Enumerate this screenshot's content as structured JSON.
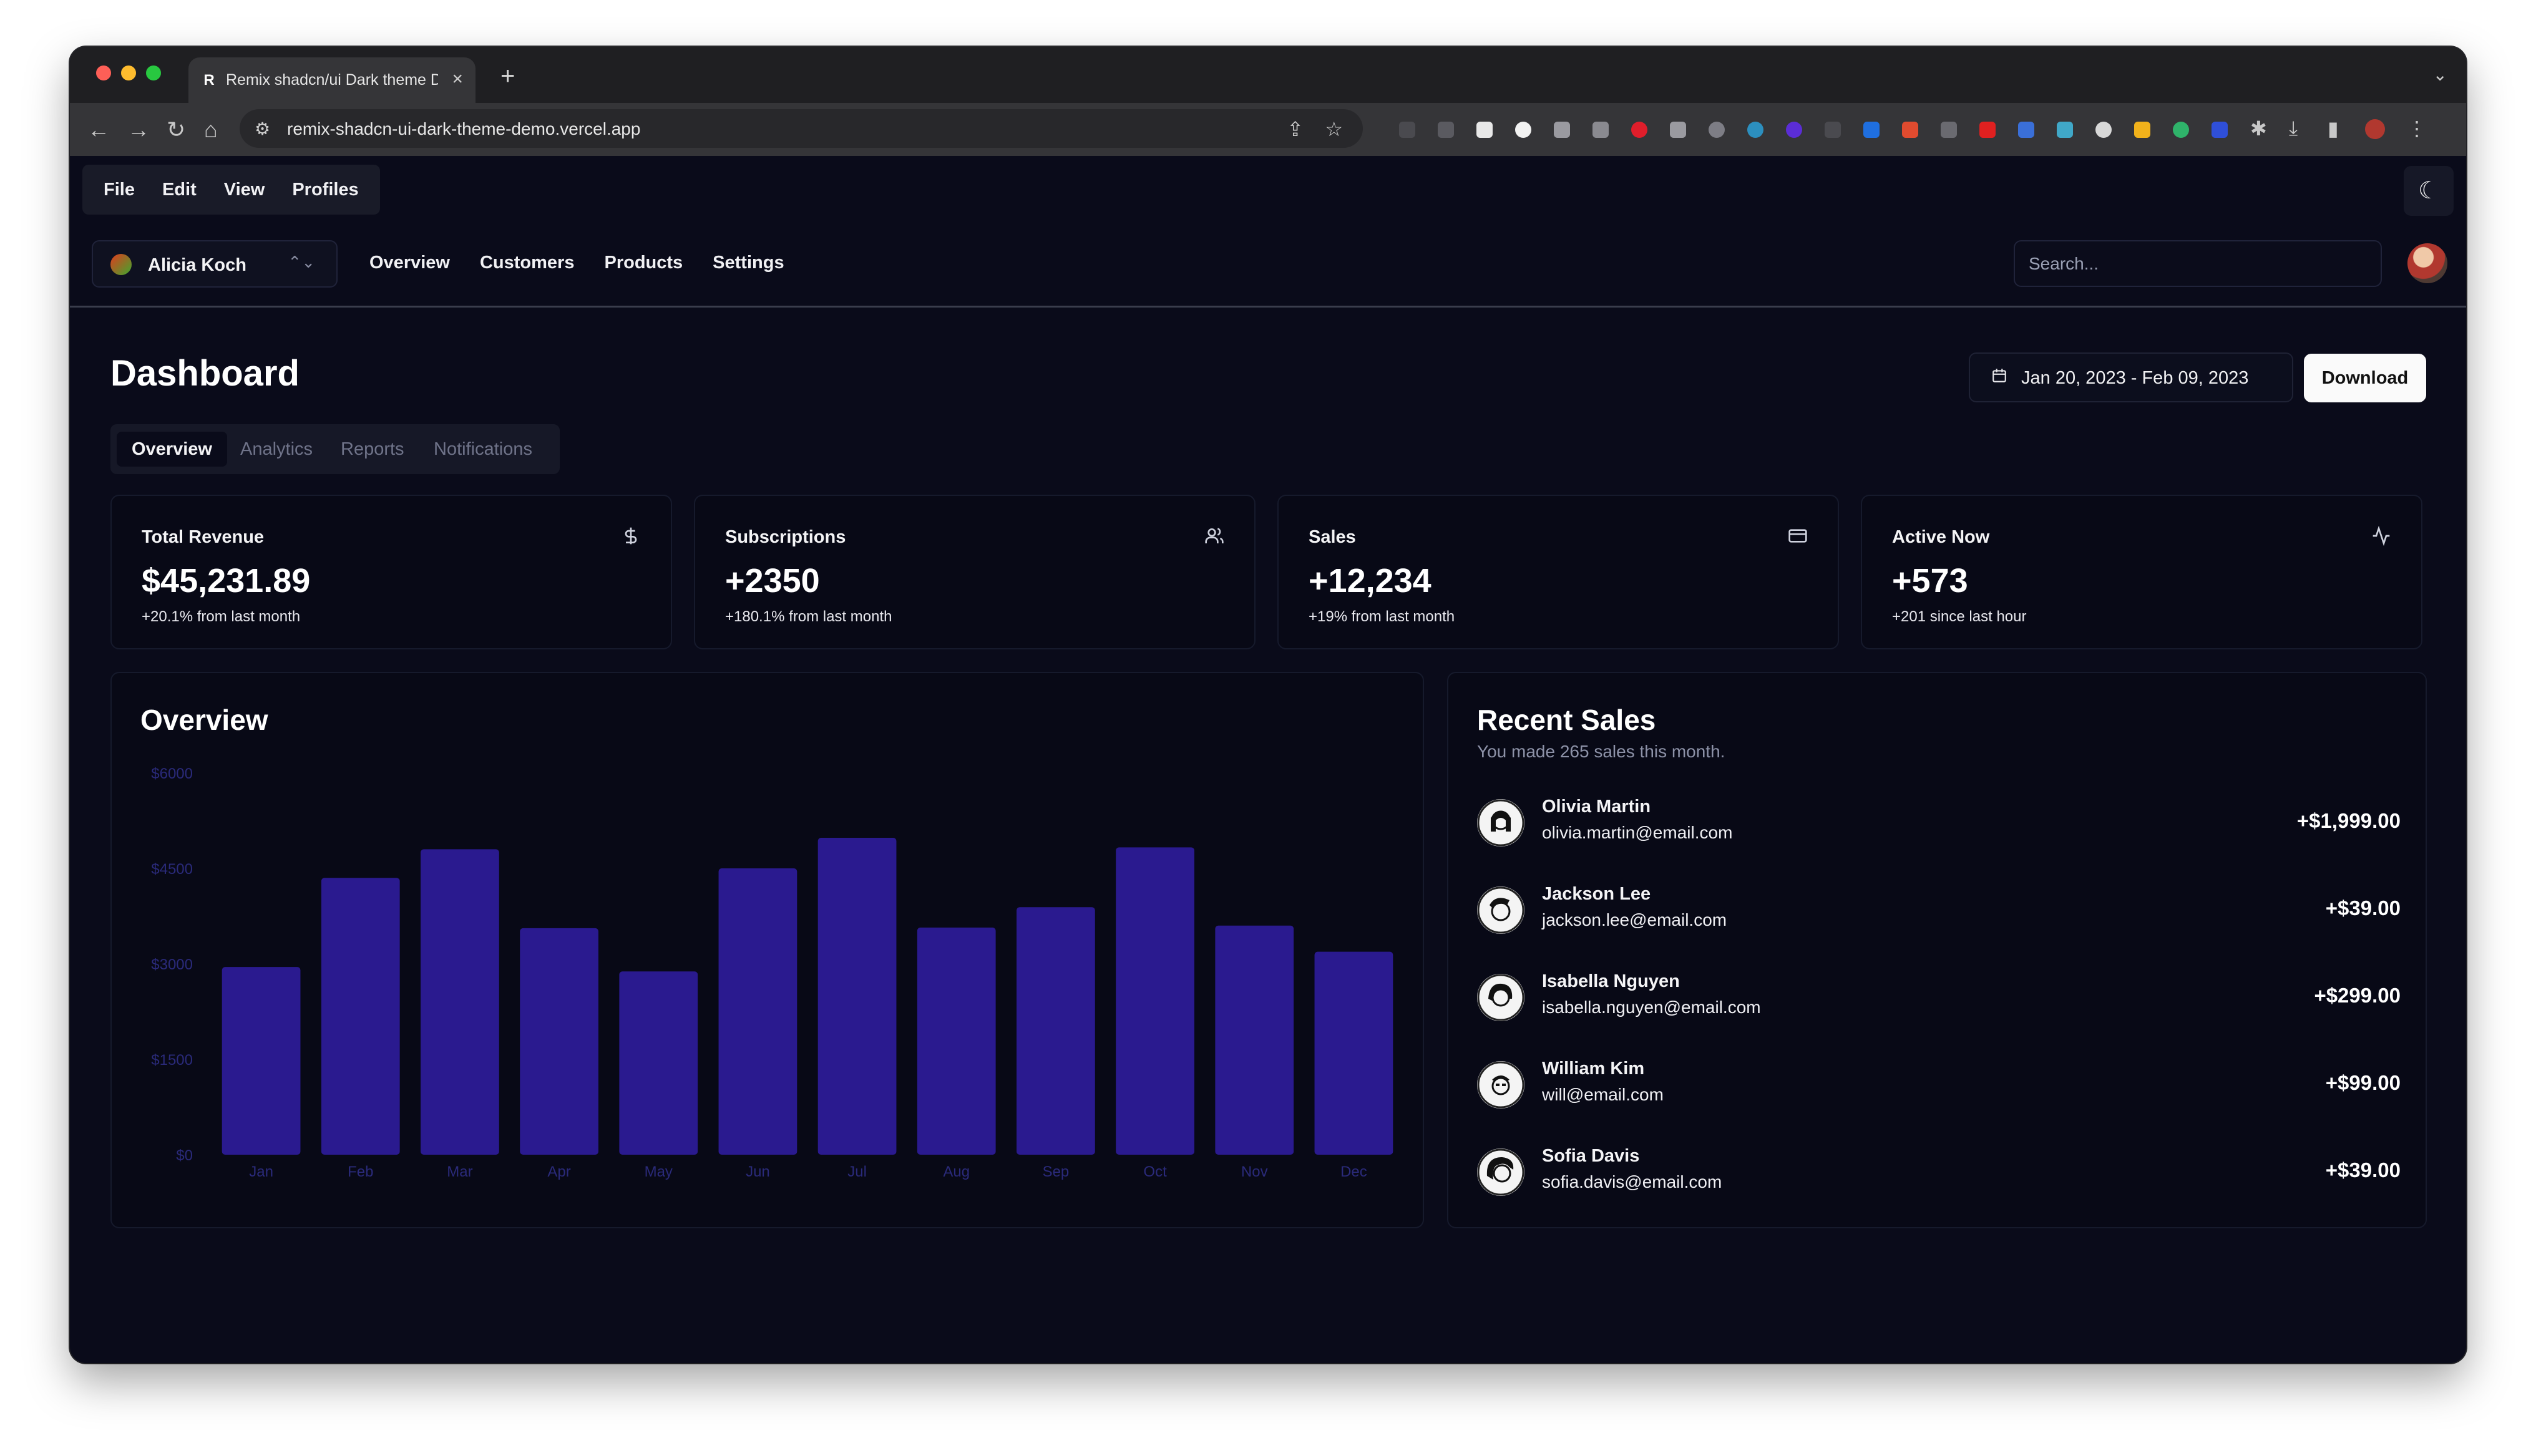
{
  "browser": {
    "tab_title": "Remix shadcn/ui Dark theme D",
    "tab_favicon": "R",
    "url": "remix-shadcn-ui-dark-theme-demo.vercel.app"
  },
  "menubar": {
    "items": [
      "File",
      "Edit",
      "View",
      "Profiles"
    ]
  },
  "team_switcher": {
    "name": "Alicia Koch"
  },
  "nav": {
    "links": [
      "Overview",
      "Customers",
      "Products",
      "Settings"
    ]
  },
  "search": {
    "placeholder": "Search..."
  },
  "page": {
    "title": "Dashboard",
    "date_range": "Jan 20, 2023 - Feb 09, 2023",
    "download_label": "Download",
    "tabs": [
      "Overview",
      "Analytics",
      "Reports",
      "Notifications"
    ],
    "active_tab": "Overview"
  },
  "stats": [
    {
      "title": "Total Revenue",
      "value": "$45,231.89",
      "sub": "+20.1% from last month",
      "icon": "dollar-icon"
    },
    {
      "title": "Subscriptions",
      "value": "+2350",
      "sub": "+180.1% from last month",
      "icon": "users-icon"
    },
    {
      "title": "Sales",
      "value": "+12,234",
      "sub": "+19% from last month",
      "icon": "credit-card-icon"
    },
    {
      "title": "Active Now",
      "value": "+573",
      "sub": "+201 since last hour",
      "icon": "activity-icon"
    }
  ],
  "overview": {
    "title": "Overview"
  },
  "chart_data": {
    "type": "bar",
    "categories": [
      "Jan",
      "Feb",
      "Mar",
      "Apr",
      "May",
      "Jun",
      "Jul",
      "Aug",
      "Sep",
      "Oct",
      "Nov",
      "Dec"
    ],
    "values": [
      2950,
      4350,
      4800,
      3560,
      2880,
      4500,
      4980,
      3570,
      3890,
      4830,
      3600,
      3190
    ],
    "ylim": [
      0,
      6000
    ],
    "yticks": [
      "$0",
      "$1500",
      "$3000",
      "$4500",
      "$6000"
    ],
    "ytick_values": [
      0,
      1500,
      3000,
      4500,
      6000
    ],
    "bar_color": "#2a1a8f",
    "axis_color": "#2a2a7a",
    "grid": false
  },
  "recent_sales": {
    "title": "Recent Sales",
    "subtitle": "You made 265 sales this month.",
    "items": [
      {
        "name": "Olivia Martin",
        "email": "olivia.martin@email.com",
        "amount": "+$1,999.00"
      },
      {
        "name": "Jackson Lee",
        "email": "jackson.lee@email.com",
        "amount": "+$39.00"
      },
      {
        "name": "Isabella Nguyen",
        "email": "isabella.nguyen@email.com",
        "amount": "+$299.00"
      },
      {
        "name": "William Kim",
        "email": "will@email.com",
        "amount": "+$99.00"
      },
      {
        "name": "Sofia Davis",
        "email": "sofia.davis@email.com",
        "amount": "+$39.00"
      }
    ]
  }
}
